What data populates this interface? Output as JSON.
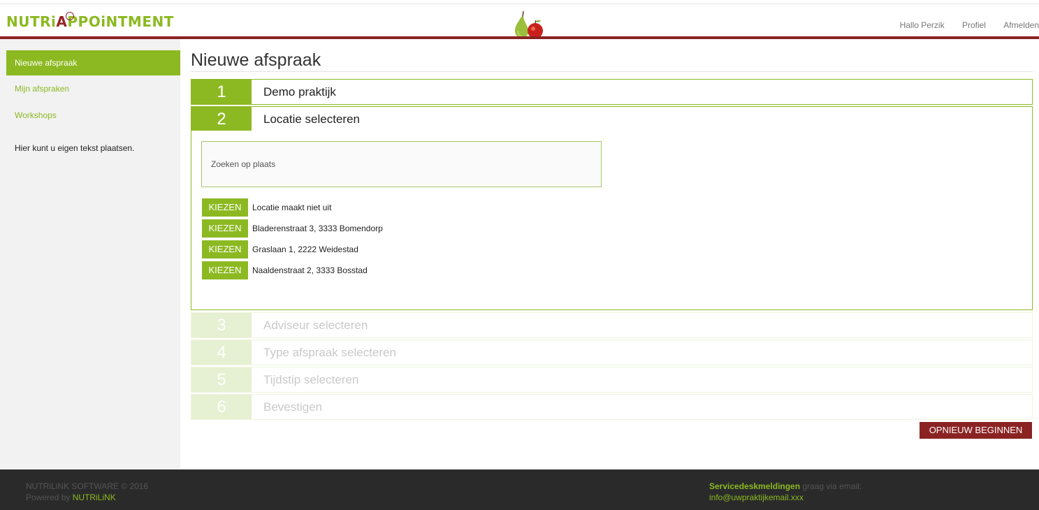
{
  "header": {
    "logo_prefix": "NUTRi",
    "logo_suffix": "PPOiNTMENT",
    "logo_a": "A",
    "nav": [
      "Hallo Perzik",
      "Profiel",
      "Afmelden"
    ]
  },
  "sidebar": {
    "items": [
      {
        "label": "Nieuwe afspraak",
        "active": true
      },
      {
        "label": "Mijn afspraken",
        "active": false
      },
      {
        "label": "Workshops",
        "active": false
      }
    ],
    "info_text": "Hier kunt u eigen tekst plaatsen."
  },
  "main": {
    "title": "Nieuwe afspraak",
    "steps": [
      {
        "number": "1",
        "label": "Demo praktijk"
      },
      {
        "number": "2",
        "label": "Locatie selecteren"
      },
      {
        "number": "3",
        "label": "Adviseur selecteren"
      },
      {
        "number": "4",
        "label": "Type afspraak selecteren"
      },
      {
        "number": "5",
        "label": "Tijdstip selecteren"
      },
      {
        "number": "6",
        "label": "Bevestigen"
      }
    ],
    "search": {
      "placeholder": "Zoeken op plaats",
      "value": ""
    },
    "choose_label": "KIEZEN",
    "locations": [
      "Locatie maakt niet uit",
      "Bladerenstraat 3, 3333 Bomendorp",
      "Graslaan 1, 2222 Weidestad",
      "Naaldenstraat 2, 3333 Bosstad"
    ],
    "restart_label": "OPNIEUW BEGINNEN"
  },
  "footer": {
    "copyright": "NUTRiLiNK SOFTWARE © 2016",
    "powered_prefix": "Powered by ",
    "powered_brand": "NUTRiLiNK",
    "servicedesk_bold": "Servicedeskmeldingen",
    "servicedesk_text": " graag via email:",
    "email": "info@uwpraktijkemail.xxx"
  },
  "colors": {
    "brand_green": "#8cb921",
    "brand_red": "#8b2323",
    "footer_bg": "#2a2a2a",
    "sidebar_bg": "#f2f2f2"
  },
  "icons": [
    "logo-mark-icon",
    "pear-apple-icon"
  ]
}
